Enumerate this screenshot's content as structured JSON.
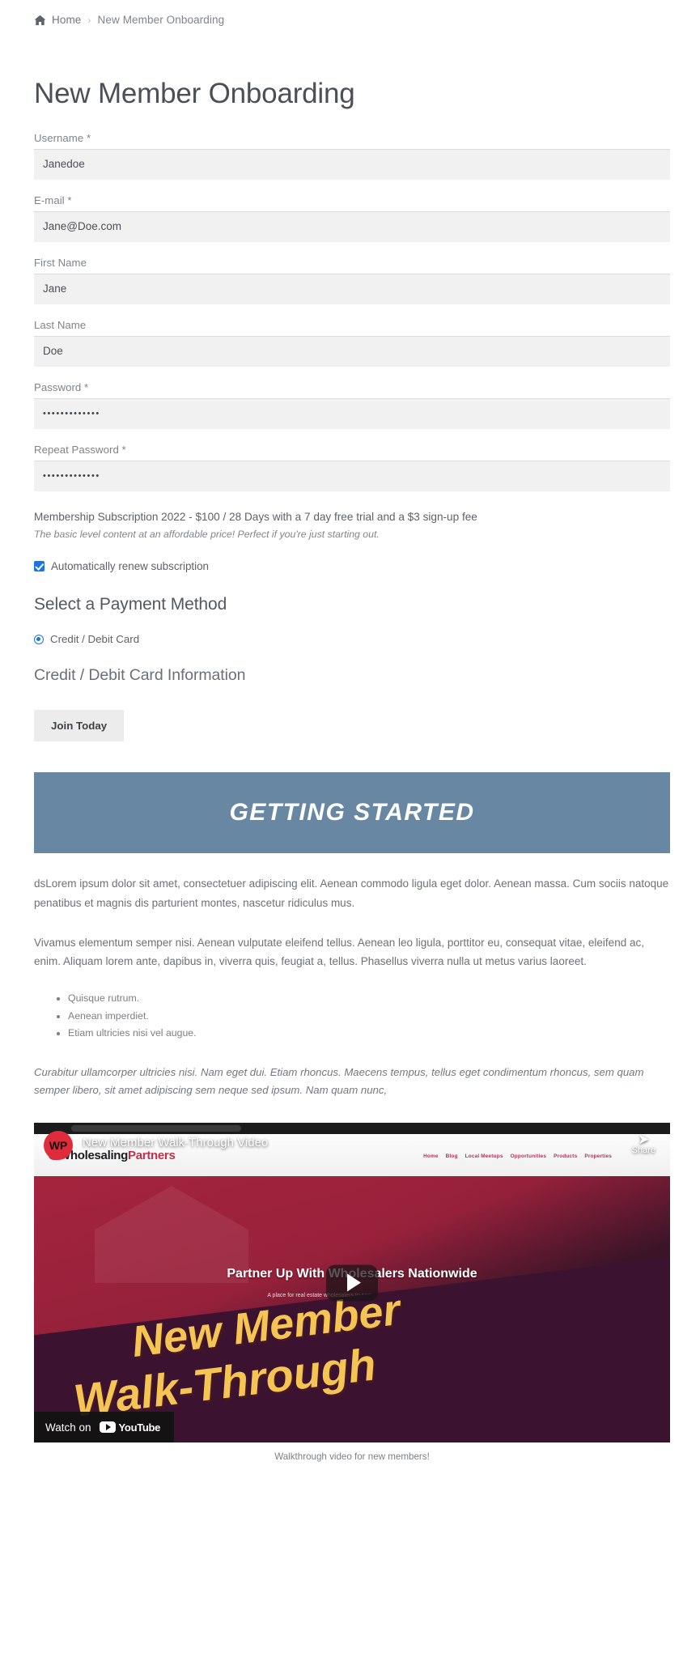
{
  "breadcrumb": {
    "home_icon": "home-icon",
    "home_label": "Home",
    "separator": "›",
    "current": "New Member Onboarding"
  },
  "page_title": "New Member Onboarding",
  "form": {
    "fields": [
      {
        "label": "Username *",
        "value": "Janedoe",
        "type": "text"
      },
      {
        "label": "E-mail *",
        "value": "Jane@Doe.com",
        "type": "email"
      },
      {
        "label": "First Name",
        "value": "Jane",
        "type": "text"
      },
      {
        "label": "Last Name",
        "value": "Doe",
        "type": "text"
      },
      {
        "label": "Password *",
        "value": "•••••••••••••",
        "type": "password"
      },
      {
        "label": "Repeat Password *",
        "value": "•••••••••••••",
        "type": "password"
      }
    ]
  },
  "subscription": {
    "title": "Membership Subscription 2022 - $100 / 28 Days with a 7 day free trial and a $3 sign-up fee",
    "description": "The basic level content at an affordable price! Perfect if you're just starting out.",
    "auto_renew_label": "Automatically renew subscription",
    "auto_renew_checked": true,
    "accent_color": "#1a73e8"
  },
  "payment": {
    "heading": "Select a Payment Method",
    "method_label": "Credit / Debit Card",
    "method_selected": true,
    "card_info_heading": "Credit / Debit Card Information",
    "submit_label": "Join Today"
  },
  "banner": {
    "text": "GETTING STARTED",
    "background_color": "#6787a3",
    "text_color": "#ffffff"
  },
  "content": {
    "paragraph_1": "dsLorem ipsum dolor sit amet, consectetuer adipiscing elit. Aenean commodo ligula eget dolor. Aenean massa. Cum sociis natoque penatibus et magnis dis parturient montes, nascetur ridiculus mus.",
    "paragraph_2": "Vivamus elementum semper nisi. Aenean vulputate eleifend tellus. Aenean leo ligula, porttitor eu, consequat vitae, eleifend ac, enim. Aliquam lorem ante, dapibus in, viverra quis, feugiat a, tellus. Phasellus viverra nulla ut metus varius laoreet.",
    "bullets": [
      "Quisque rutrum.",
      "Aenean imperdiet.",
      "Etiam ultricies nisi vel augue."
    ],
    "paragraph_3": "Curabitur ullamcorper ultricies nisi. Nam eget dui. Etiam rhoncus. Maecens tempus, tellus eget condimentum rhoncus, sem quam semper libero, sit amet adipiscing sem neque sed ipsum. Nam quam nunc,"
  },
  "video": {
    "title_overlay": "New Member Walk-Through Video",
    "channel_avatar": "WP",
    "share_label": "Share",
    "share_icon": "share-arrow-icon",
    "play_icon": "play-button-icon",
    "watch_on_label": "Watch on",
    "youtube_label": "YouTube",
    "site_logo_main": "Wholesaling",
    "site_logo_accent": "Partners",
    "site_nav": [
      "Home",
      "Blog",
      "Local Meetups",
      "Opportunities",
      "Products",
      "Properties"
    ],
    "hero_tagline": "Partner Up With Wholesalers Nationwide",
    "hero_subtagline": "A place for real estate wholesalers to partner up, network, and grow",
    "thumb_text_line1": "New Member",
    "thumb_text_line2": "Walk-Through",
    "caption": "Walkthrough video for new members!"
  }
}
